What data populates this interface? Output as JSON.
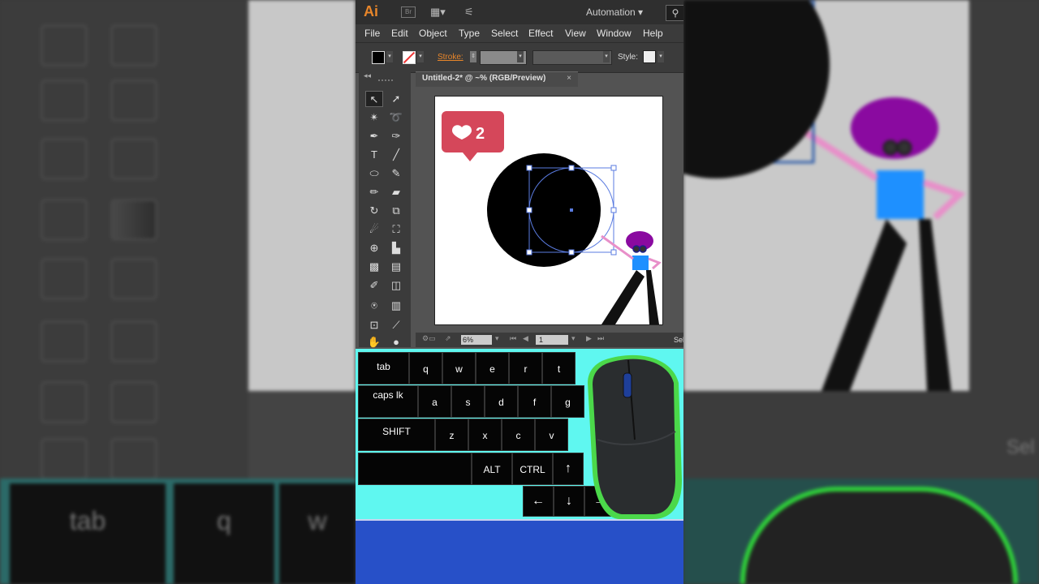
{
  "app": {
    "logo": "Ai",
    "bridge": "Br",
    "workspace": "Automation ▾",
    "search_icon": "search-icon"
  },
  "menu": [
    "File",
    "Edit",
    "Object",
    "Type",
    "Select",
    "Effect",
    "View",
    "Window",
    "Help"
  ],
  "control": {
    "stroke_label": "Stroke:",
    "style_label": "Style:"
  },
  "document": {
    "tab_title": "Untitled-2* @ ~% (RGB/Preview)",
    "close": "×"
  },
  "status": {
    "zoom": "6%",
    "page": "1",
    "selection": "Sel"
  },
  "like_badge": {
    "count": "2",
    "color": "#d5475a"
  },
  "keyboard": {
    "row1": [
      "tab",
      "q",
      "w",
      "e",
      "r",
      "t"
    ],
    "row2": [
      "caps lk",
      "a",
      "s",
      "d",
      "f",
      "g"
    ],
    "row3": [
      "SHIFT",
      "z",
      "x",
      "c",
      "v"
    ],
    "row4": [
      "",
      "ALT",
      "CTRL",
      "↑"
    ],
    "row5": [
      "←",
      "↓",
      "→"
    ]
  },
  "background": {
    "keys": [
      "tab",
      "q",
      "w"
    ],
    "right_text": "Sel"
  },
  "colors": {
    "accent": "#e8862a",
    "cyan": "#5ff7f0",
    "blue": "#2750c8",
    "purple": "#8a0aa0",
    "shirt": "#1e90ff"
  }
}
